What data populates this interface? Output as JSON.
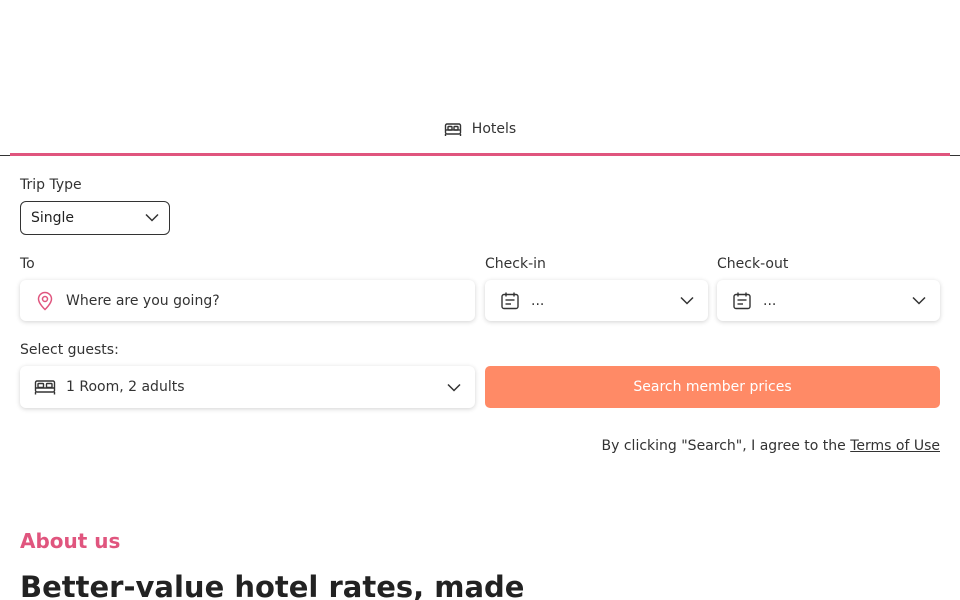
{
  "tabs": [
    {
      "label": "Hotels",
      "icon": "bed-icon"
    }
  ],
  "form": {
    "trip_type": {
      "label": "Trip Type",
      "value": "Single"
    },
    "to": {
      "label": "To",
      "placeholder": "Where are you going?",
      "icon": "location-pin-icon"
    },
    "checkin": {
      "label": "Check-in",
      "value": "...",
      "icon": "calendar-icon"
    },
    "checkout": {
      "label": "Check-out",
      "value": "...",
      "icon": "calendar-icon"
    },
    "guests": {
      "label": "Select guests:",
      "value": "1 Room, 2 adults",
      "icon": "bed-icon"
    },
    "search_button": "Search member prices",
    "terms_prefix": "By clicking \"Search\", I agree to the ",
    "terms_link": "Terms of Use"
  },
  "about": {
    "eyebrow": "About us",
    "headline": "Better-value hotel rates, made"
  },
  "colors": {
    "accent": "#e0557e",
    "search_button": "#ff8a66"
  }
}
